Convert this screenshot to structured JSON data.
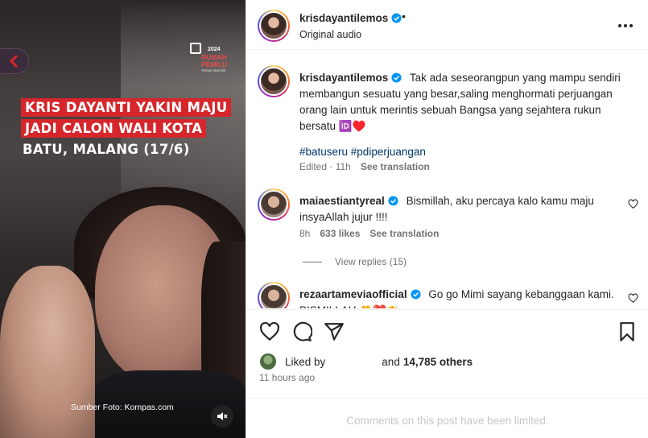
{
  "media": {
    "headline_lines": [
      "KRIS DAYANTI YAKIN MAJU",
      "JADI CALON WALI KOTA",
      "BATU, MALANG (17/6)"
    ],
    "badge_year": "2024",
    "badge_title": "RUMAH PEMILU",
    "badge_subtitle": "Teman Memilih",
    "source_credit": "Sumber Foto: Kompas.com",
    "back_icon": "chevron-left-icon",
    "mute_icon": "muted-speaker-icon"
  },
  "post_header": {
    "username": "krisdayantilemos",
    "separator": "•",
    "audio": "Original audio",
    "more_icon": "more-dots-icon"
  },
  "caption": {
    "username": "krisdayantilemos",
    "text": "Tak ada seseorangpun yang mampu sendiri membangun sesuatu yang besar,saling menghormati perjuangan orang lain untuk merintis sebuah Bangsa yang sejahtera rukun bersatu 🆔♥️",
    "hashtags": "#batuseru #pdiperjuangan",
    "edited_time": "Edited · 11h",
    "see_translation": "See translation"
  },
  "comments": [
    {
      "username": "maiaestiantyreal",
      "text": "Bismillah, aku percaya kalo kamu maju insyaAllah jujur !!!!",
      "time": "8h",
      "likes": "633 likes",
      "see_translation": "See translation",
      "view_replies": "View replies (15)"
    },
    {
      "username": "rezaartameviaofficial",
      "text": "Go go Mimi sayang kebanggaan kami. BISMILLAH 🤲❤️👏"
    }
  ],
  "actions": {
    "like_icon": "heart-icon",
    "comment_icon": "comment-icon",
    "share_icon": "share-icon",
    "save_icon": "bookmark-icon"
  },
  "likes": {
    "liked_by": "Liked by",
    "and": "and",
    "others": "14,785 others"
  },
  "posted_time": "11 hours ago",
  "comments_limited": "Comments on this post have been limited.",
  "colors": {
    "headline_red": "#d6262b",
    "verified_blue": "#0095f6",
    "hashtag": "#00376b",
    "muted_text": "#737373"
  }
}
